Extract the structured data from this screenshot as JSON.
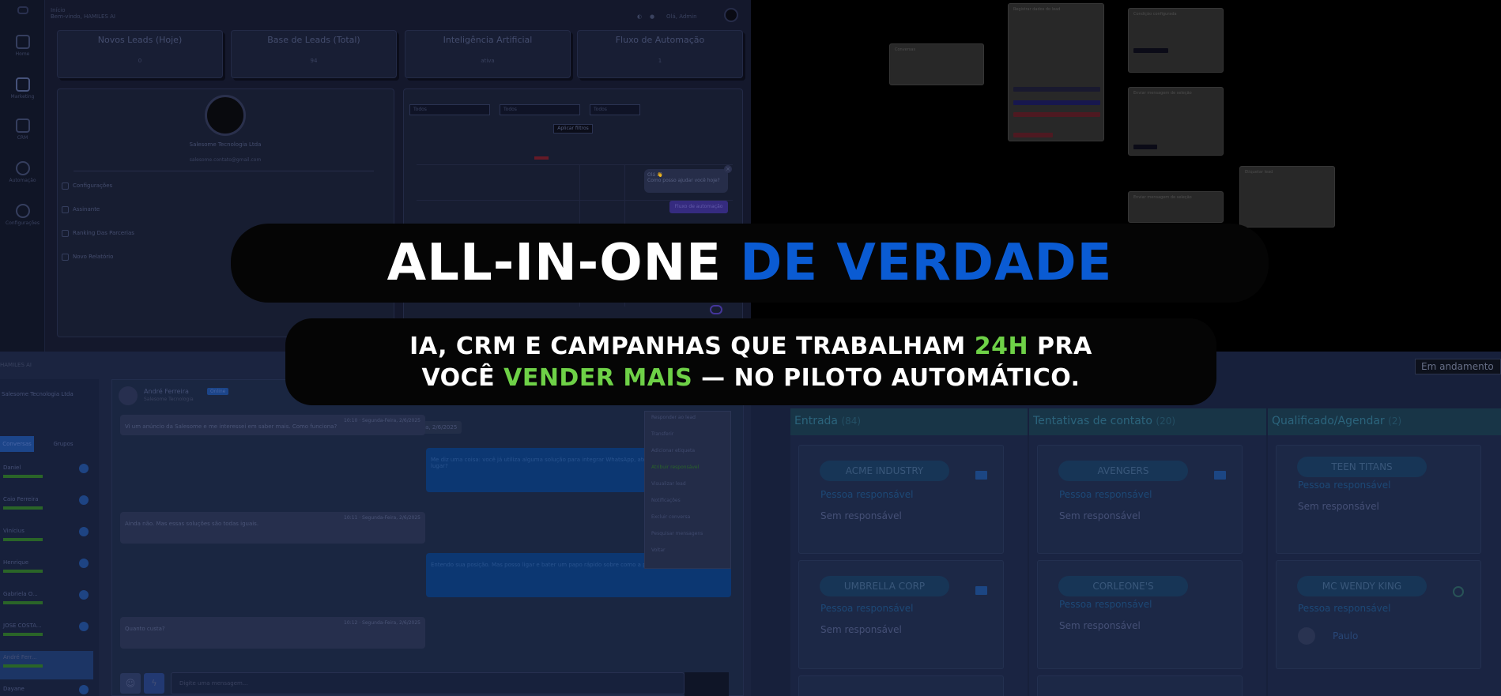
{
  "dashboard": {
    "header": {
      "line1": "Início",
      "line2": "Bem-vindo, HAMILES AI",
      "user": "Olá, Admin"
    },
    "sidebar": [
      {
        "label": "Home"
      },
      {
        "label": "Marketing"
      },
      {
        "label": "CRM"
      },
      {
        "label": "Automação"
      },
      {
        "label": "Configurações"
      }
    ],
    "stats": [
      {
        "title": "Novos Leads (Hoje)",
        "value": "0"
      },
      {
        "title": "Base de Leads (Total)",
        "value": "94"
      },
      {
        "title": "Inteligência Artificial",
        "value": "ativa"
      },
      {
        "title": "Fluxo de Automação",
        "value": "1"
      }
    ],
    "profile": {
      "name": "Salesome Tecnologia Ltda",
      "email": "salesome.contato@gmail.com"
    },
    "menu": [
      {
        "label": "Configurações"
      },
      {
        "label": "Assinante"
      },
      {
        "label": "Ranking Das Parcerias"
      },
      {
        "label": "Novo Relatório"
      }
    ],
    "filters": [
      {
        "label": "Todos"
      },
      {
        "label": "Todos"
      },
      {
        "label": "Todos"
      }
    ],
    "filter_button": "Aplicar filtros",
    "chat_popup": {
      "greeting": "Olá 👋",
      "text": "Como posso ajudar você hoje?"
    },
    "flow_button": "Fluxo de automação"
  },
  "flow": {
    "nodes": [
      {
        "title": "Conversas"
      },
      {
        "title": "Registrar dados do lead"
      },
      {
        "title": "Condição configurada"
      },
      {
        "title": "Enviar mensagem de seleção"
      },
      {
        "title": "Etiquetar lead"
      },
      {
        "title": "Enviar mensagem de seleção"
      }
    ]
  },
  "chat": {
    "app": "HAMILES AI",
    "company": "Salesome Tecnologia Ltda",
    "tabs": [
      "Conversas",
      "Grupos"
    ],
    "contacts": [
      {
        "name": "Daniel"
      },
      {
        "name": "Caio Ferreira"
      },
      {
        "name": "Vinícius"
      },
      {
        "name": "Henrique"
      },
      {
        "name": "Gabriela O..."
      },
      {
        "name": "JOSE COSTA..."
      },
      {
        "name": "André Ferr..."
      },
      {
        "name": "Dayane"
      }
    ],
    "current_contact": {
      "name": "André Ferreira",
      "badge": "Online",
      "sub": "Salesome Tecnologia"
    },
    "tooltip": "Segunda-Feira, 2/6/2025",
    "messages": [
      {
        "dir": "in",
        "meta": "10:10 · Segunda-Feira, 2/6/2025",
        "text": "Vi um anúncio da Salesome e me interessei em saber mais. Como funciona?"
      },
      {
        "dir": "out",
        "meta": "10:11",
        "text": "Me diz uma coisa: você já utiliza alguma solução para integrar WhatsApp, atendimento e CRM em um só lugar?"
      },
      {
        "dir": "in",
        "meta": "10:11 · Segunda-Feira, 2/6/2025",
        "text": "Ainda não. Mas essas soluções são todas iguais."
      },
      {
        "dir": "out",
        "meta": "10:12",
        "text": "Entendo sua posição. Mas posso ligar e bater um papo rápido sobre como a plataforma pode te ajudar?"
      },
      {
        "dir": "in",
        "meta": "10:12 · Segunda-Feira, 2/6/2025",
        "text": "Quanto custa?"
      }
    ],
    "context_menu": [
      "Responder ao lead",
      "Transferir",
      "Adicionar etiqueta",
      "Atribuir responsável",
      "Visualizar lead",
      "Notificações",
      "Excluir conversa",
      "Pesquisar mensagens",
      "Voltar"
    ],
    "input_placeholder": "Digite uma mensagem..."
  },
  "kanban": {
    "status_button": "Em andamento",
    "columns": [
      {
        "title": "Entrada",
        "count": "(84)",
        "cards": [
          {
            "company": "ACME INDUSTRY",
            "resp_label": "Pessoa responsável",
            "resp_value": "Sem responsável",
            "channel": "email"
          },
          {
            "company": "UMBRELLA CORP",
            "resp_label": "Pessoa responsável",
            "resp_value": "Sem responsável",
            "channel": "email"
          }
        ]
      },
      {
        "title": "Tentativas de contato",
        "count": "(20)",
        "cards": [
          {
            "company": "AVENGERS",
            "resp_label": "Pessoa responsável",
            "resp_value": "Sem responsável",
            "channel": "email"
          },
          {
            "company": "CORLEONE'S",
            "resp_label": "Pessoa responsável",
            "resp_value": "Sem responsável",
            "channel": "none"
          }
        ]
      },
      {
        "title": "Qualificado/Agendar",
        "count": "(2)",
        "cards": [
          {
            "company": "TEEN TITANS",
            "resp_label": "Pessoa responsável",
            "resp_value": "Sem responsável",
            "channel": "none"
          },
          {
            "company": "MC WENDY KING",
            "resp_label": "Pessoa responsável",
            "resp_value": "Paulo",
            "channel": "whatsapp"
          }
        ]
      }
    ]
  },
  "headline": {
    "part1": "ALL-IN-ONE",
    "part2": "DE VERDADE"
  },
  "subheadline": {
    "l1a": "IA, CRM E CAMPANHAS QUE TRABALHAM ",
    "l1b": "24H",
    "l1c": " PRA",
    "l2a": "VOCÊ ",
    "l2b": "VENDER MAIS",
    "l2c": " — NO PILOTO AUTOMÁTICO."
  },
  "colors": {
    "accent_blue": "#0a5bd3",
    "accent_green": "#6ed147",
    "bg": "#050505"
  }
}
